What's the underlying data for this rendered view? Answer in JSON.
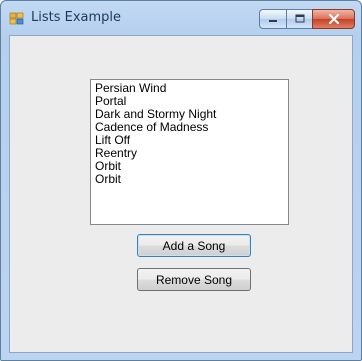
{
  "window": {
    "title": "Lists Example",
    "icon": "winforms-app-icon",
    "caption_buttons": [
      "minimize-icon",
      "maximize-icon",
      "close-icon"
    ]
  },
  "songs_list": {
    "items": [
      "Persian Wind",
      "Portal",
      "Dark and Stormy Night",
      "Cadence of Madness",
      "Lift Off",
      "Reentry",
      "Orbit",
      "Orbit"
    ]
  },
  "buttons": {
    "add_label": "Add a Song",
    "remove_label": "Remove Song"
  },
  "colors": {
    "title_text": "#1e395b",
    "close_button": "#c74128",
    "client_background": "#ececec"
  }
}
